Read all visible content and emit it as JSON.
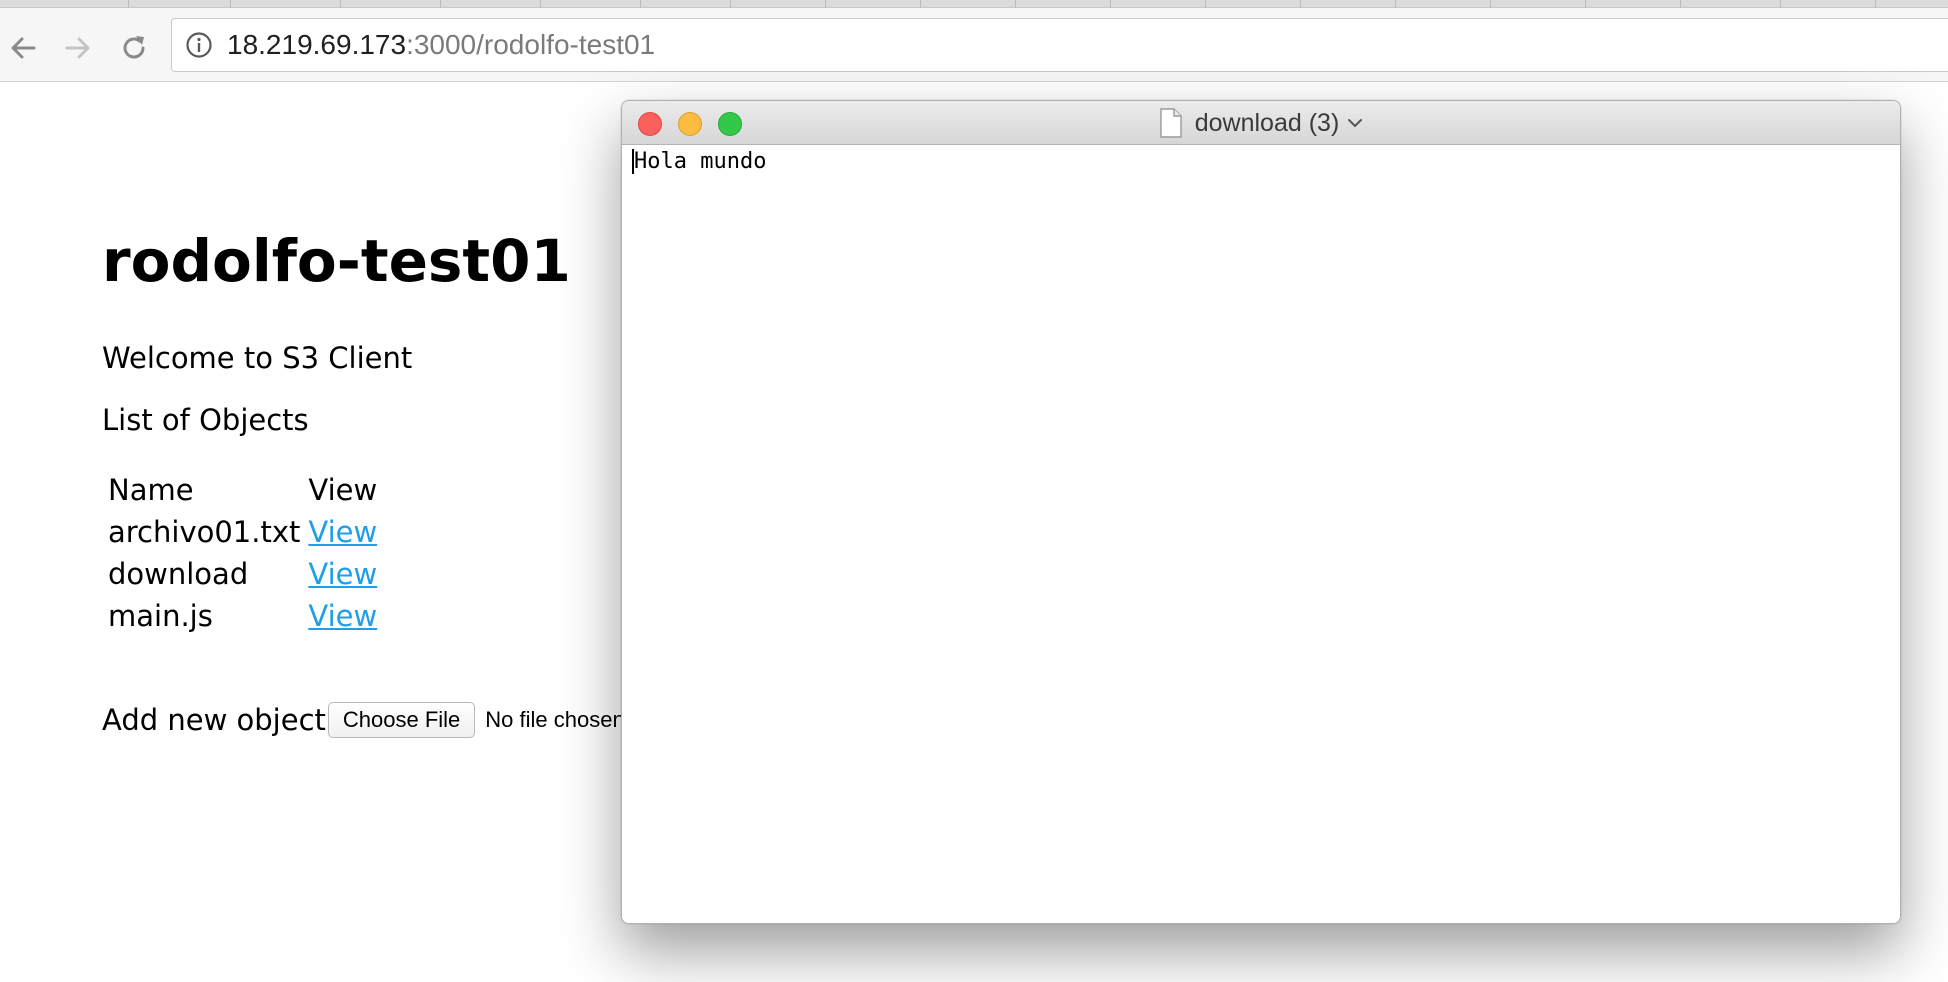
{
  "browser": {
    "url_host": "18.219.69.173",
    "url_rest": ":3000/rodolfo-test01",
    "icons": {
      "back": "back-arrow-icon",
      "forward": "forward-arrow-icon",
      "reload": "reload-icon",
      "info": "info-icon"
    }
  },
  "page": {
    "title": "rodolfo-test01",
    "welcome": "Welcome to S3 Client",
    "list_heading": "List of Objects",
    "table": {
      "headers": [
        "Name",
        "View"
      ],
      "rows": [
        {
          "name": "archivo01.txt",
          "link": "View"
        },
        {
          "name": "download",
          "link": "View"
        },
        {
          "name": "main.js",
          "link": "View"
        }
      ]
    },
    "add_label": "Add new object",
    "choose_file_label": "Choose File",
    "no_file_text": "No file chosen",
    "link_color": "#1e9fe8"
  },
  "window": {
    "title": "download (3)",
    "content": "Hola mundo",
    "traffic_colors": {
      "close": "#fc605b",
      "minimize": "#fdbc40",
      "maximize": "#34c84a"
    }
  }
}
